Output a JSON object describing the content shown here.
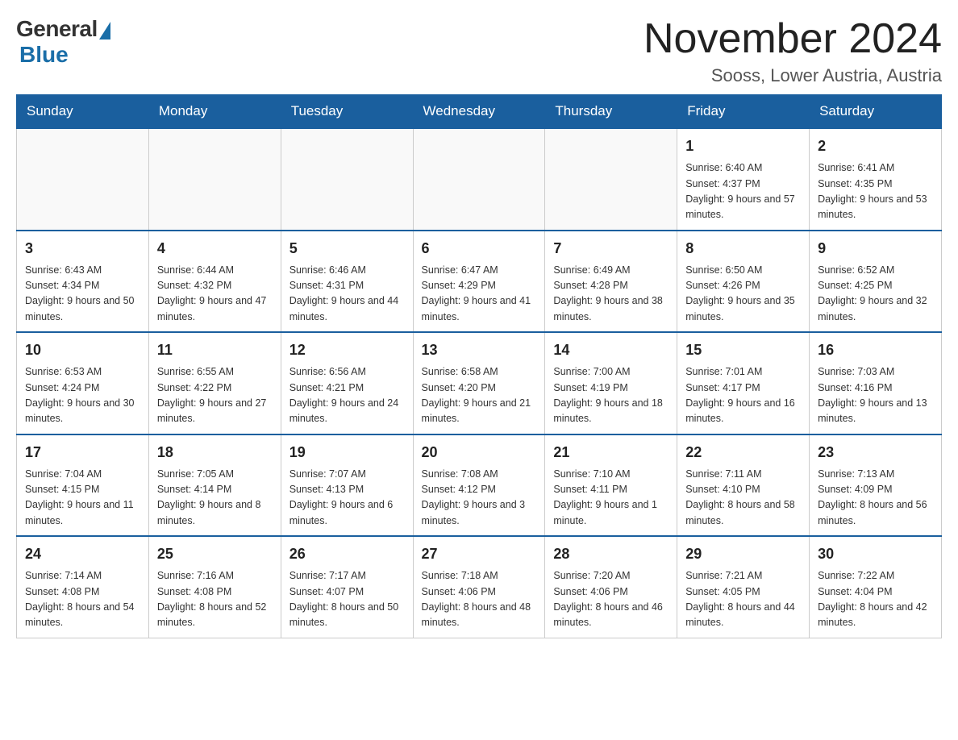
{
  "logo": {
    "general": "General",
    "blue": "Blue"
  },
  "title": "November 2024",
  "location": "Sooss, Lower Austria, Austria",
  "weekdays": [
    "Sunday",
    "Monday",
    "Tuesday",
    "Wednesday",
    "Thursday",
    "Friday",
    "Saturday"
  ],
  "weeks": [
    [
      {
        "day": "",
        "info": ""
      },
      {
        "day": "",
        "info": ""
      },
      {
        "day": "",
        "info": ""
      },
      {
        "day": "",
        "info": ""
      },
      {
        "day": "",
        "info": ""
      },
      {
        "day": "1",
        "info": "Sunrise: 6:40 AM\nSunset: 4:37 PM\nDaylight: 9 hours and 57 minutes."
      },
      {
        "day": "2",
        "info": "Sunrise: 6:41 AM\nSunset: 4:35 PM\nDaylight: 9 hours and 53 minutes."
      }
    ],
    [
      {
        "day": "3",
        "info": "Sunrise: 6:43 AM\nSunset: 4:34 PM\nDaylight: 9 hours and 50 minutes."
      },
      {
        "day": "4",
        "info": "Sunrise: 6:44 AM\nSunset: 4:32 PM\nDaylight: 9 hours and 47 minutes."
      },
      {
        "day": "5",
        "info": "Sunrise: 6:46 AM\nSunset: 4:31 PM\nDaylight: 9 hours and 44 minutes."
      },
      {
        "day": "6",
        "info": "Sunrise: 6:47 AM\nSunset: 4:29 PM\nDaylight: 9 hours and 41 minutes."
      },
      {
        "day": "7",
        "info": "Sunrise: 6:49 AM\nSunset: 4:28 PM\nDaylight: 9 hours and 38 minutes."
      },
      {
        "day": "8",
        "info": "Sunrise: 6:50 AM\nSunset: 4:26 PM\nDaylight: 9 hours and 35 minutes."
      },
      {
        "day": "9",
        "info": "Sunrise: 6:52 AM\nSunset: 4:25 PM\nDaylight: 9 hours and 32 minutes."
      }
    ],
    [
      {
        "day": "10",
        "info": "Sunrise: 6:53 AM\nSunset: 4:24 PM\nDaylight: 9 hours and 30 minutes."
      },
      {
        "day": "11",
        "info": "Sunrise: 6:55 AM\nSunset: 4:22 PM\nDaylight: 9 hours and 27 minutes."
      },
      {
        "day": "12",
        "info": "Sunrise: 6:56 AM\nSunset: 4:21 PM\nDaylight: 9 hours and 24 minutes."
      },
      {
        "day": "13",
        "info": "Sunrise: 6:58 AM\nSunset: 4:20 PM\nDaylight: 9 hours and 21 minutes."
      },
      {
        "day": "14",
        "info": "Sunrise: 7:00 AM\nSunset: 4:19 PM\nDaylight: 9 hours and 18 minutes."
      },
      {
        "day": "15",
        "info": "Sunrise: 7:01 AM\nSunset: 4:17 PM\nDaylight: 9 hours and 16 minutes."
      },
      {
        "day": "16",
        "info": "Sunrise: 7:03 AM\nSunset: 4:16 PM\nDaylight: 9 hours and 13 minutes."
      }
    ],
    [
      {
        "day": "17",
        "info": "Sunrise: 7:04 AM\nSunset: 4:15 PM\nDaylight: 9 hours and 11 minutes."
      },
      {
        "day": "18",
        "info": "Sunrise: 7:05 AM\nSunset: 4:14 PM\nDaylight: 9 hours and 8 minutes."
      },
      {
        "day": "19",
        "info": "Sunrise: 7:07 AM\nSunset: 4:13 PM\nDaylight: 9 hours and 6 minutes."
      },
      {
        "day": "20",
        "info": "Sunrise: 7:08 AM\nSunset: 4:12 PM\nDaylight: 9 hours and 3 minutes."
      },
      {
        "day": "21",
        "info": "Sunrise: 7:10 AM\nSunset: 4:11 PM\nDaylight: 9 hours and 1 minute."
      },
      {
        "day": "22",
        "info": "Sunrise: 7:11 AM\nSunset: 4:10 PM\nDaylight: 8 hours and 58 minutes."
      },
      {
        "day": "23",
        "info": "Sunrise: 7:13 AM\nSunset: 4:09 PM\nDaylight: 8 hours and 56 minutes."
      }
    ],
    [
      {
        "day": "24",
        "info": "Sunrise: 7:14 AM\nSunset: 4:08 PM\nDaylight: 8 hours and 54 minutes."
      },
      {
        "day": "25",
        "info": "Sunrise: 7:16 AM\nSunset: 4:08 PM\nDaylight: 8 hours and 52 minutes."
      },
      {
        "day": "26",
        "info": "Sunrise: 7:17 AM\nSunset: 4:07 PM\nDaylight: 8 hours and 50 minutes."
      },
      {
        "day": "27",
        "info": "Sunrise: 7:18 AM\nSunset: 4:06 PM\nDaylight: 8 hours and 48 minutes."
      },
      {
        "day": "28",
        "info": "Sunrise: 7:20 AM\nSunset: 4:06 PM\nDaylight: 8 hours and 46 minutes."
      },
      {
        "day": "29",
        "info": "Sunrise: 7:21 AM\nSunset: 4:05 PM\nDaylight: 8 hours and 44 minutes."
      },
      {
        "day": "30",
        "info": "Sunrise: 7:22 AM\nSunset: 4:04 PM\nDaylight: 8 hours and 42 minutes."
      }
    ]
  ]
}
